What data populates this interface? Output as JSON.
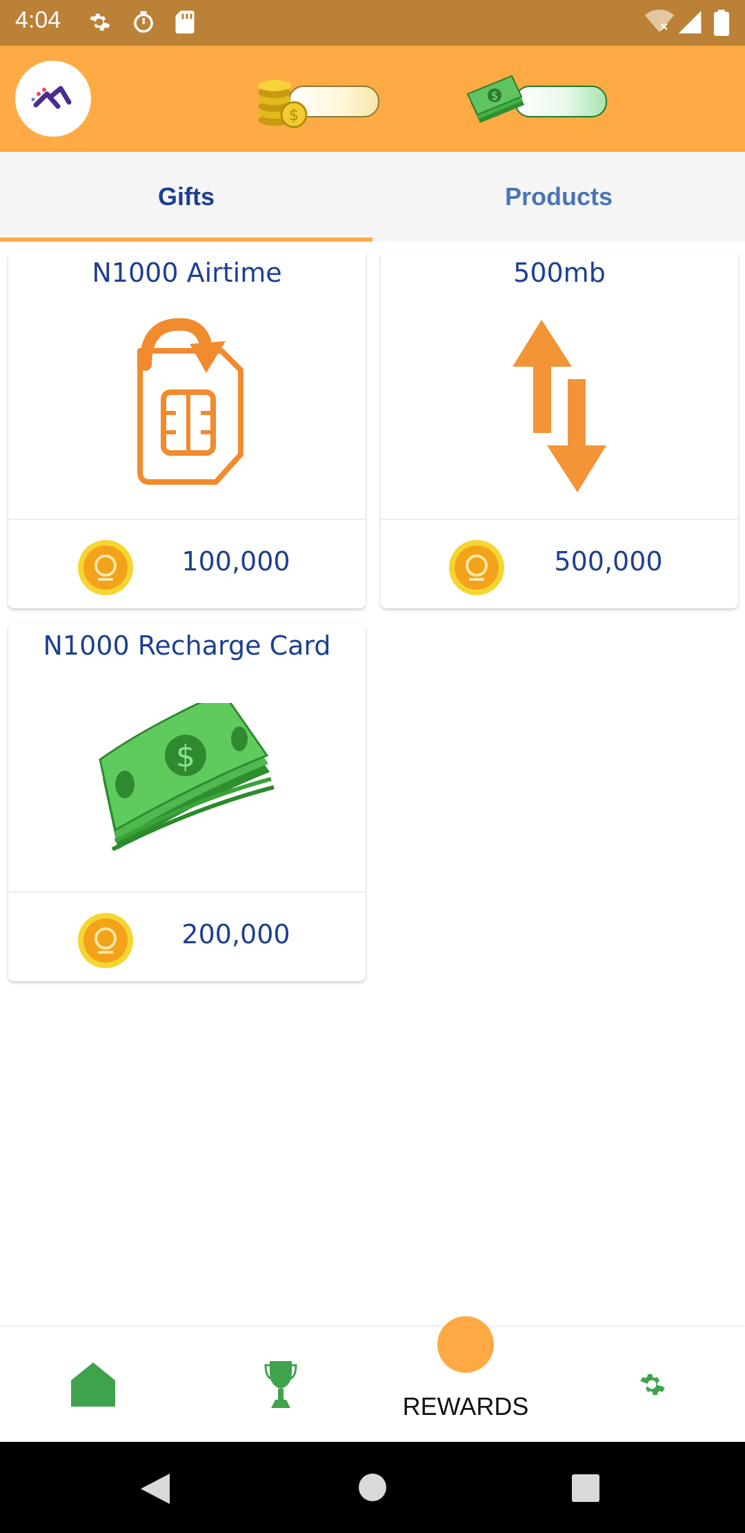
{
  "status_bar": {
    "time": "4:04",
    "icons": [
      "settings-icon",
      "timer-icon",
      "sd-card-icon",
      "wifi-off-icon",
      "signal-icon",
      "battery-icon"
    ]
  },
  "app_bar": {
    "logo": "app-logo",
    "coin_balance": "",
    "cash_balance": ""
  },
  "tabs": [
    {
      "label": "Gifts",
      "active": true
    },
    {
      "label": "Products",
      "active": false
    }
  ],
  "gifts": [
    {
      "title": "N1000 Airtime",
      "price": "100,000",
      "image": "sim-airtime-icon"
    },
    {
      "title": "500mb",
      "price": "500,000",
      "image": "data-arrows-icon"
    },
    {
      "title": "N1000 Recharge Card",
      "price": "200,000",
      "image": "cash-stack-icon"
    }
  ],
  "bottom_nav": {
    "items": [
      {
        "name": "home",
        "icon": "home-icon"
      },
      {
        "name": "leaderboard",
        "icon": "trophy-icon"
      },
      {
        "name": "rewards",
        "icon": "rewards-icon",
        "label": "REWARDS"
      },
      {
        "name": "settings",
        "icon": "gear-icon"
      }
    ]
  },
  "colors": {
    "status_bar": "#bb8137",
    "accent": "#ffaa44",
    "title_text": "#1c3f8f",
    "inactive_tab": "#4a74b8",
    "nav_green": "#3fa34d"
  }
}
